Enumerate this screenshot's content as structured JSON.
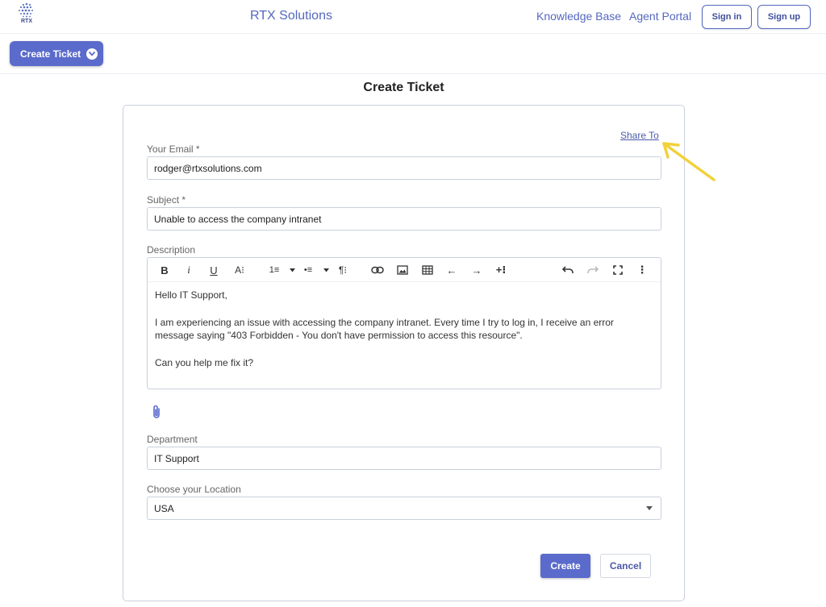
{
  "header": {
    "logo_text": "RTX",
    "brand": "RTX Solutions",
    "nav": {
      "knowledge_base": "Knowledge Base",
      "agent_portal": "Agent Portal"
    },
    "sign_in": "Sign in",
    "sign_up": "Sign up"
  },
  "subbar": {
    "create_ticket_label": "Create Ticket",
    "icon": "chevron-down-icon"
  },
  "page": {
    "title": "Create Ticket"
  },
  "form": {
    "share_link": "Share To",
    "email": {
      "label": "Your Email *",
      "value": "rodger@rtxsolutions.com"
    },
    "subject": {
      "label": "Subject *",
      "value": "Unable to access the company intranet"
    },
    "description": {
      "label": "Description",
      "toolbar": {
        "bold": "B",
        "italic": "i",
        "underline": "U",
        "font_size": "A⁝",
        "ordered_list": "1≡",
        "bullet_list": "•≡",
        "paragraph": "¶⁝",
        "arrow_left": "←",
        "arrow_right": "→",
        "more_insert": "+⁝",
        "more": "⋮"
      },
      "paragraphs": [
        "Hello IT Support,",
        "I am experiencing an issue with accessing the company intranet. Every time I try to log in, I receive an error message saying \"403 Forbidden - You don't have permission to access this resource\".",
        "Can you help me fix it?"
      ]
    },
    "attachment_icon": "paperclip-icon",
    "department": {
      "label": "Department",
      "value": "IT Support"
    },
    "location": {
      "label": "Choose your Location",
      "value": "USA"
    },
    "create_button": "Create",
    "cancel_button": "Cancel"
  },
  "colors": {
    "accent": "#5a6bcb",
    "link": "#5468c0",
    "annotation_arrow": "#f2d13b",
    "border": "#c9d0dc"
  }
}
